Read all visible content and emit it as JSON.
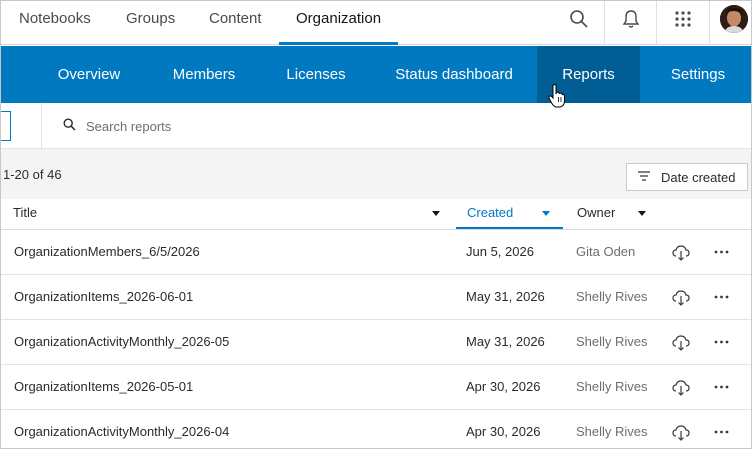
{
  "top_nav": {
    "tabs": [
      {
        "label": "Notebooks"
      },
      {
        "label": "Groups"
      },
      {
        "label": "Content"
      },
      {
        "label": "Organization"
      }
    ],
    "active_tab": "Organization",
    "icons": [
      "search-icon",
      "bell-icon",
      "app-launcher-icon",
      "avatar"
    ]
  },
  "sub_nav": {
    "tabs": [
      {
        "label": "Overview"
      },
      {
        "label": "Members"
      },
      {
        "label": "Licenses"
      },
      {
        "label": "Status dashboard"
      },
      {
        "label": "Reports"
      },
      {
        "label": "Settings"
      }
    ],
    "active_tab": "Reports"
  },
  "search": {
    "placeholder": "Search reports",
    "value": ""
  },
  "results": {
    "count_text": "1-20 of 46"
  },
  "sort": {
    "label": "Date created"
  },
  "table": {
    "columns": [
      {
        "label": "Title"
      },
      {
        "label": "Created"
      },
      {
        "label": "Owner"
      }
    ],
    "active_sort_column": "Created",
    "rows": [
      {
        "title": "OrganizationMembers_6/5/2026",
        "created": "Jun 5, 2026",
        "owner": "Gita Oden"
      },
      {
        "title": "OrganizationItems_2026-06-01",
        "created": "May 31, 2026",
        "owner": "Shelly Rives"
      },
      {
        "title": "OrganizationActivityMonthly_2026-05",
        "created": "May 31, 2026",
        "owner": "Shelly Rives"
      },
      {
        "title": "OrganizationItems_2026-05-01",
        "created": "Apr 30, 2026",
        "owner": "Shelly Rives"
      },
      {
        "title": "OrganizationActivityMonthly_2026-04",
        "created": "Apr 30, 2026",
        "owner": "Shelly Rives"
      }
    ]
  },
  "colors": {
    "brand_blue": "#0079c1",
    "active_blue": "#005e95",
    "link_blue": "#007ac2"
  }
}
